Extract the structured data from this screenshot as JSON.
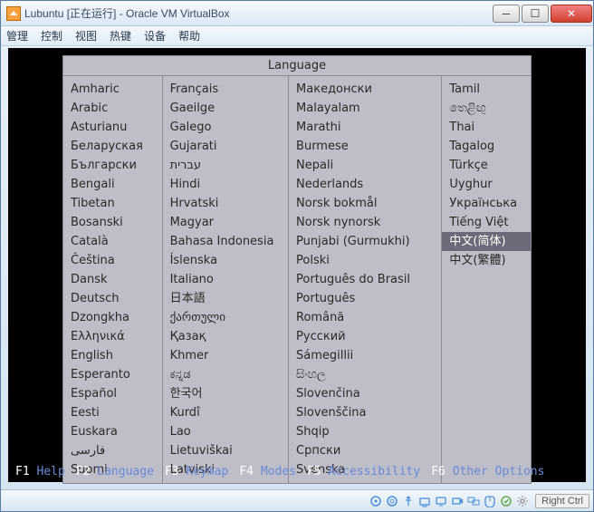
{
  "titlebar": {
    "text": "Lubuntu [正在运行] - Oracle VM VirtualBox"
  },
  "menu": {
    "m0": "管理",
    "m1": "控制",
    "m2": "视图",
    "m3": "热键",
    "m4": "设备",
    "m5": "帮助"
  },
  "lang_header": "Language",
  "columns": [
    [
      "Amharic",
      "Arabic",
      "Asturianu",
      "Беларуская",
      "Български",
      "Bengali",
      "Tibetan",
      "Bosanski",
      "Català",
      "Čeština",
      "Dansk",
      "Deutsch",
      "Dzongkha",
      "Ελληνικά",
      "English",
      "Esperanto",
      "Español",
      "Eesti",
      "Euskara",
      "فارسی",
      "Suomi"
    ],
    [
      "Français",
      "Gaeilge",
      "Galego",
      "Gujarati",
      "עברית",
      "Hindi",
      "Hrvatski",
      "Magyar",
      "Bahasa Indonesia",
      "Íslenska",
      "Italiano",
      "日本語",
      "ქართული",
      "Қазақ",
      "Khmer",
      "ಕನ್ನಡ",
      "한국어",
      "Kurdî",
      "Lao",
      "Lietuviškai",
      "Latviski"
    ],
    [
      "Македонски",
      "Malayalam",
      "Marathi",
      "Burmese",
      "Nepali",
      "Nederlands",
      "Norsk bokmål",
      "Norsk nynorsk",
      "Punjabi (Gurmukhi)",
      "Polski",
      "Português do Brasil",
      "Português",
      "Română",
      "Русский",
      "Sámegillii",
      "සිංහල",
      "Slovenčina",
      "Slovenščina",
      "Shqip",
      "Српски",
      "Svenska"
    ],
    [
      "Tamil",
      "තෙළිඟු",
      "Thai",
      "Tagalog",
      "Türkçe",
      "Uyghur",
      "Українська",
      "Tiếng Việt",
      "中文(简体)",
      "中文(繁體)"
    ]
  ],
  "selected_index": {
    "col": 3,
    "row": 8
  },
  "fkeys": [
    {
      "key": "F1",
      "label": "Help"
    },
    {
      "key": "F2",
      "label": "Language"
    },
    {
      "key": "F3",
      "label": "Keymap"
    },
    {
      "key": "F4",
      "label": "Modes"
    },
    {
      "key": "F5",
      "label": "Accessibility"
    },
    {
      "key": "F6",
      "label": "Other Options"
    }
  ],
  "host_key": "Right Ctrl",
  "status_icons": [
    "device-hdd",
    "device-cd",
    "device-usb",
    "device-shared",
    "device-display",
    "device-recording",
    "device-monitors",
    "mouse-integration",
    "virtualization",
    "settings"
  ]
}
